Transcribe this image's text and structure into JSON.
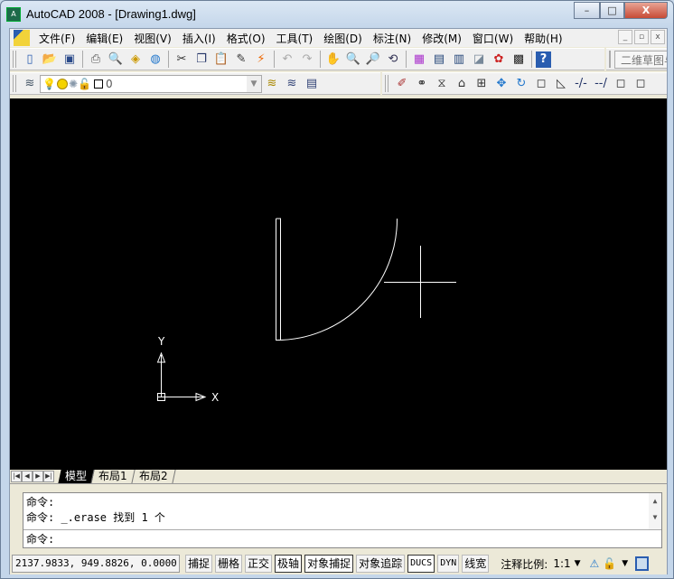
{
  "window": {
    "title": "AutoCAD 2008 - [Drawing1.dwg]",
    "minimize": "–",
    "maximize": "□",
    "close": "X"
  },
  "menu": [
    "文件(F)",
    "编辑(E)",
    "视图(V)",
    "插入(I)",
    "格式(O)",
    "工具(T)",
    "绘图(D)",
    "标注(N)",
    "修改(M)",
    "窗口(W)",
    "帮助(H)"
  ],
  "mdi": {
    "minimize": "_",
    "restore": "▫",
    "close": "x"
  },
  "toolbar_standard": [
    {
      "icon": "new-icon",
      "glyph": "▯",
      "color": "#2a5db0"
    },
    {
      "icon": "open-icon",
      "glyph": "📂",
      "color": "#c9a020"
    },
    {
      "icon": "save-icon",
      "glyph": "▣",
      "color": "#2a4a8a"
    },
    "|",
    {
      "icon": "plot-icon",
      "glyph": "⎙",
      "color": "#555"
    },
    {
      "icon": "plot-preview-icon",
      "glyph": "🔍",
      "color": "#555"
    },
    {
      "icon": "publish-icon",
      "glyph": "◈",
      "color": "#c90"
    },
    {
      "icon": "3d-dwf-icon",
      "glyph": "◍",
      "color": "#27c"
    },
    "|",
    {
      "icon": "cut-icon",
      "glyph": "✂",
      "color": "#333"
    },
    {
      "icon": "copy-icon",
      "glyph": "❐",
      "color": "#236"
    },
    {
      "icon": "paste-icon",
      "glyph": "📋",
      "color": "#a80"
    },
    {
      "icon": "match-properties-icon",
      "glyph": "✎",
      "color": "#333"
    },
    {
      "icon": "block-editor-icon",
      "glyph": "⚡",
      "color": "#e60"
    },
    "|",
    {
      "icon": "undo-icon",
      "glyph": "↶",
      "color": "#aaa"
    },
    {
      "icon": "redo-icon",
      "glyph": "↷",
      "color": "#aaa"
    },
    "|",
    {
      "icon": "pan-icon",
      "glyph": "✋",
      "color": "#a33"
    },
    {
      "icon": "zoom-realtime-icon",
      "glyph": "🔍",
      "color": "#333"
    },
    {
      "icon": "zoom-window-icon",
      "glyph": "🔎",
      "color": "#333"
    },
    {
      "icon": "zoom-previous-icon",
      "glyph": "⟲",
      "color": "#335"
    },
    "|",
    {
      "icon": "properties-icon",
      "glyph": "▦",
      "color": "#a3c"
    },
    {
      "icon": "design-center-icon",
      "glyph": "▤",
      "color": "#247"
    },
    {
      "icon": "tool-palettes-icon",
      "glyph": "▥",
      "color": "#247"
    },
    {
      "icon": "sheet-set-icon",
      "glyph": "◪",
      "color": "#789"
    },
    {
      "icon": "markup-icon",
      "glyph": "✿",
      "color": "#c22"
    },
    {
      "icon": "calculator-icon",
      "glyph": "▩",
      "color": "#222"
    },
    "|",
    {
      "icon": "help-icon",
      "glyph": "?",
      "color": "#fff",
      "bg": "#2a5db0"
    }
  ],
  "workspace": "二维草图与注释",
  "layer": {
    "value": "0",
    "icons": [
      "layers-icon",
      "light-bulb-icon",
      "sun-icon",
      "freeze-icon",
      "lock-icon"
    ]
  },
  "toolbar_layer_tail": [
    {
      "icon": "make-current-icon",
      "glyph": "≋",
      "color": "#a80"
    },
    {
      "icon": "layer-previous-icon",
      "glyph": "≋",
      "color": "#347"
    },
    {
      "icon": "layer-states-icon",
      "glyph": "▤",
      "color": "#347"
    }
  ],
  "toolbar_modify": [
    {
      "icon": "erase-icon",
      "glyph": "✐",
      "color": "#a33"
    },
    {
      "icon": "copy-object-icon",
      "glyph": "⚭",
      "color": "#333"
    },
    {
      "icon": "mirror-icon",
      "glyph": "⧖",
      "color": "#333"
    },
    {
      "icon": "offset-icon",
      "glyph": "⌂",
      "color": "#333"
    },
    {
      "icon": "array-icon",
      "glyph": "⊞",
      "color": "#333"
    },
    {
      "icon": "move-icon",
      "glyph": "✥",
      "color": "#27c"
    },
    {
      "icon": "rotate-icon",
      "glyph": "↻",
      "color": "#27c"
    },
    {
      "icon": "scale-icon",
      "glyph": "◻",
      "color": "#333"
    },
    {
      "icon": "stretch-icon",
      "glyph": "◺",
      "color": "#333"
    },
    {
      "icon": "trim-icon",
      "glyph": "-/-",
      "color": "#236"
    },
    {
      "icon": "extend-icon",
      "glyph": "--/",
      "color": "#236"
    },
    {
      "icon": "break-icon",
      "glyph": "◻",
      "color": "#333"
    },
    {
      "icon": "join-icon",
      "glyph": "◻",
      "color": "#333"
    }
  ],
  "tabs": {
    "nav": [
      "|◀",
      "◀",
      "▶",
      "▶|"
    ],
    "items": [
      "模型",
      "布局1",
      "布局2"
    ],
    "active": 0
  },
  "command": {
    "history": [
      "命令:",
      "命令: _.erase 找到 1 个"
    ],
    "prompt": "命令:",
    "scroll_up": "▲",
    "scroll_down": "▼"
  },
  "status": {
    "coords": "2137.9833, 949.8826, 0.0000",
    "toggles": [
      {
        "label": "捕捉",
        "on": false
      },
      {
        "label": "栅格",
        "on": false
      },
      {
        "label": "正交",
        "on": false
      },
      {
        "label": "极轴",
        "on": true
      },
      {
        "label": "对象捕捉",
        "on": true
      },
      {
        "label": "对象追踪",
        "on": false
      },
      {
        "label": "DUCS",
        "on": true
      },
      {
        "label": "DYN",
        "on": false
      },
      {
        "label": "线宽",
        "on": false
      }
    ],
    "annotation_scale_label": "注释比例:",
    "annotation_scale": "1:1"
  },
  "ucs": {
    "x": "X",
    "y": "Y"
  }
}
